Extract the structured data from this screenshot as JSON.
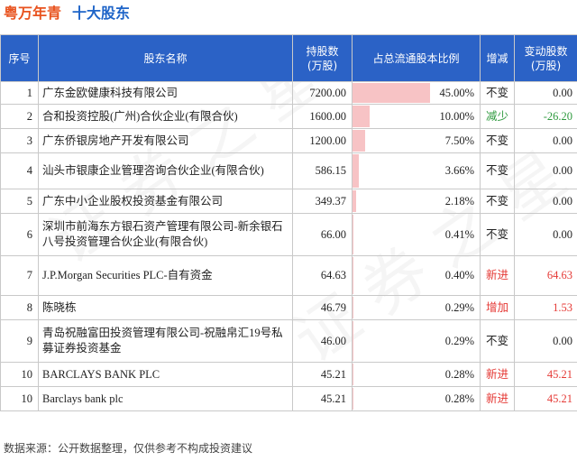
{
  "header": {
    "company": "粤万年青",
    "subtitle": "十大股东"
  },
  "table": {
    "columns": [
      "序号",
      "股东名称",
      "持股数\n(万股)",
      "占总流通股本比例",
      "增减",
      "变动股数\n(万股)"
    ],
    "rows": [
      {
        "index": "1",
        "name": "广东金欧健康科技有限公司",
        "shares": "7200.00",
        "ratio": "45.00%",
        "ratio_value": 45.0,
        "change": "不变",
        "change_type": "flat",
        "delta": "0.00"
      },
      {
        "index": "2",
        "name": "合和投资控股(广州)合伙企业(有限合伙)",
        "shares": "1600.00",
        "ratio": "10.00%",
        "ratio_value": 10.0,
        "change": "减少",
        "change_type": "down",
        "delta": "-26.20"
      },
      {
        "index": "3",
        "name": "广东侨银房地产开发有限公司",
        "shares": "1200.00",
        "ratio": "7.50%",
        "ratio_value": 7.5,
        "change": "不变",
        "change_type": "flat",
        "delta": "0.00"
      },
      {
        "index": "4",
        "name": "汕头市银康企业管理咨询合伙企业(有限合伙)",
        "shares": "586.15",
        "ratio": "3.66%",
        "ratio_value": 3.66,
        "change": "不变",
        "change_type": "flat",
        "delta": "0.00"
      },
      {
        "index": "5",
        "name": "广东中小企业股权投资基金有限公司",
        "shares": "349.37",
        "ratio": "2.18%",
        "ratio_value": 2.18,
        "change": "不变",
        "change_type": "flat",
        "delta": "0.00"
      },
      {
        "index": "6",
        "name": "深圳市前海东方银石资产管理有限公司-新余银石八号投资管理合伙企业(有限合伙)",
        "shares": "66.00",
        "ratio": "0.41%",
        "ratio_value": 0.41,
        "change": "不变",
        "change_type": "flat",
        "delta": "0.00"
      },
      {
        "index": "7",
        "name": "J.P.Morgan Securities PLC-自有资金",
        "shares": "64.63",
        "ratio": "0.40%",
        "ratio_value": 0.4,
        "change": "新进",
        "change_type": "up",
        "delta": "64.63"
      },
      {
        "index": "8",
        "name": "陈晓栋",
        "shares": "46.79",
        "ratio": "0.29%",
        "ratio_value": 0.29,
        "change": "增加",
        "change_type": "up",
        "delta": "1.53"
      },
      {
        "index": "9",
        "name": "青岛祝融富田投资管理有限公司-祝融帛汇19号私募证券投资基金",
        "shares": "46.00",
        "ratio": "0.29%",
        "ratio_value": 0.29,
        "change": "不变",
        "change_type": "flat",
        "delta": "0.00"
      },
      {
        "index": "10",
        "name": "BARCLAYS BANK PLC",
        "shares": "45.21",
        "ratio": "0.28%",
        "ratio_value": 0.28,
        "change": "新进",
        "change_type": "up",
        "delta": "45.21"
      },
      {
        "index": "10",
        "name": "Barclays bank plc",
        "shares": "45.21",
        "ratio": "0.28%",
        "ratio_value": 0.28,
        "change": "新进",
        "change_type": "up",
        "delta": "45.21"
      }
    ]
  },
  "footer": {
    "source": "数据来源：公开数据整理，仅供参考不构成投资建议"
  },
  "colors": {
    "accent_orange": "#e8531f",
    "accent_blue": "#1e64c8",
    "header_bg": "#2b62c6",
    "bar": "#f7c3c5",
    "up": "#e53935",
    "down": "#2e9a3e"
  }
}
